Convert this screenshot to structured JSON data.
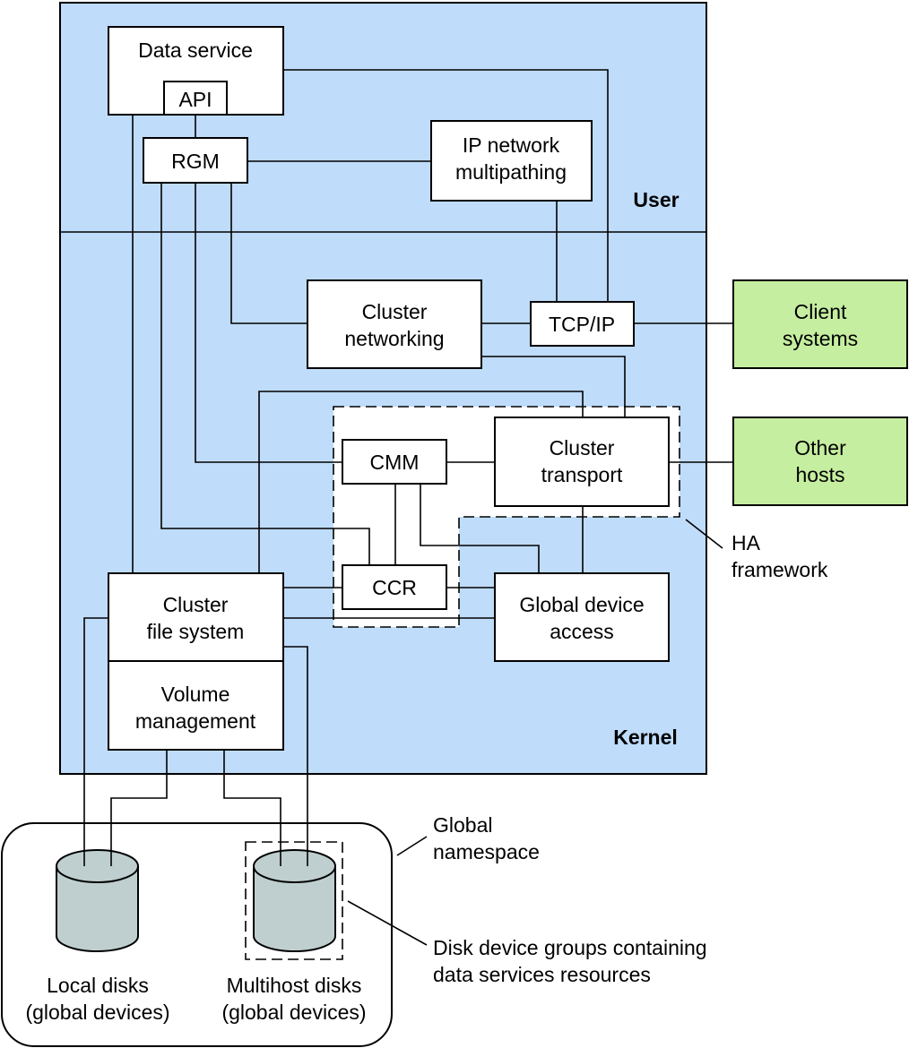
{
  "regions": {
    "user": "User",
    "kernel": "Kernel"
  },
  "components": {
    "data_service": "Data service",
    "api": "API",
    "rgm": "RGM",
    "ip_multipathing": [
      "IP network",
      "multipathing"
    ],
    "cluster_networking": [
      "Cluster",
      "networking"
    ],
    "tcpip": "TCP/IP",
    "client_systems": [
      "Client",
      "systems"
    ],
    "other_hosts": [
      "Other",
      "hosts"
    ],
    "cmm": "CMM",
    "cluster_transport": [
      "Cluster",
      "transport"
    ],
    "ccr": "CCR",
    "global_device_access": [
      "Global device",
      "access"
    ],
    "cluster_file_system": [
      "Cluster",
      "file system"
    ],
    "volume_management": [
      "Volume",
      "management"
    ]
  },
  "annotations": {
    "ha_framework": [
      "HA",
      "framework"
    ],
    "global_namespace": [
      "Global",
      "namespace"
    ],
    "disk_device_groups": [
      "Disk device groups containing",
      "data services resources"
    ]
  },
  "disks": {
    "local": [
      "Local disks",
      "(global devices)"
    ],
    "multihost": [
      "Multihost disks",
      "(global devices)"
    ]
  },
  "colors": {
    "kernel_user_bg": "#bfdcfa",
    "external_hosts": "#c5eea0",
    "disk": "#bfcfcf"
  }
}
